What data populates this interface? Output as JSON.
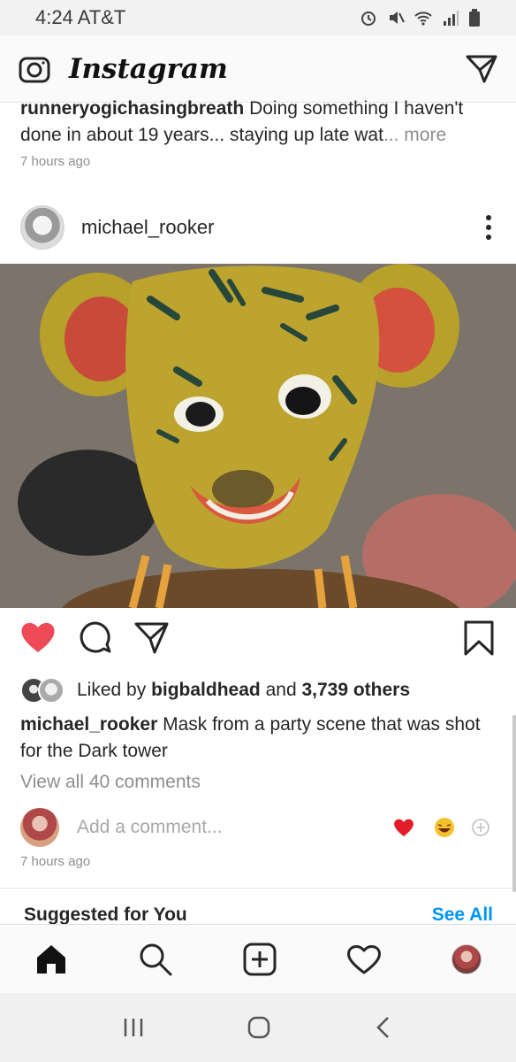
{
  "status_bar": {
    "time_carrier": "4:24 AT&T",
    "icons": [
      "alarm-icon",
      "mute-icon",
      "wifi-icon",
      "signal-icon",
      "battery-icon"
    ]
  },
  "header": {
    "logo": "Instagram",
    "icons": [
      "camera-icon",
      "direct-message-icon"
    ]
  },
  "previous_post": {
    "username": "runneryogichasingbreath",
    "caption": "Doing something I haven't done in about 19 years... staying up late wat",
    "more": "... more",
    "timestamp": "7 hours ago"
  },
  "post": {
    "username": "michael_rooker",
    "image_alt": "Mask",
    "liked_by_prefix": "Liked by ",
    "liked_by_user": "bigbaldhead",
    "liked_by_mid": " and ",
    "liked_by_others": "3,739 others",
    "caption_user": "michael_rooker",
    "caption_text": "Mask from a party scene that was shot for the Dark tower",
    "view_comments": "View all 40 comments",
    "add_comment_placeholder": "Add a comment...",
    "quick_reactions": [
      "❤️",
      "😂",
      "+"
    ],
    "timestamp": "7 hours ago",
    "liked": true
  },
  "suggested": {
    "title": "Suggested for You",
    "see_all": "See All"
  },
  "tab_bar": {
    "items": [
      "home",
      "search",
      "create",
      "activity",
      "profile"
    ]
  },
  "colors": {
    "heart": "#ed4956",
    "link_blue": "#0095f6",
    "text": "#262626",
    "muted": "#8e8e8e"
  }
}
